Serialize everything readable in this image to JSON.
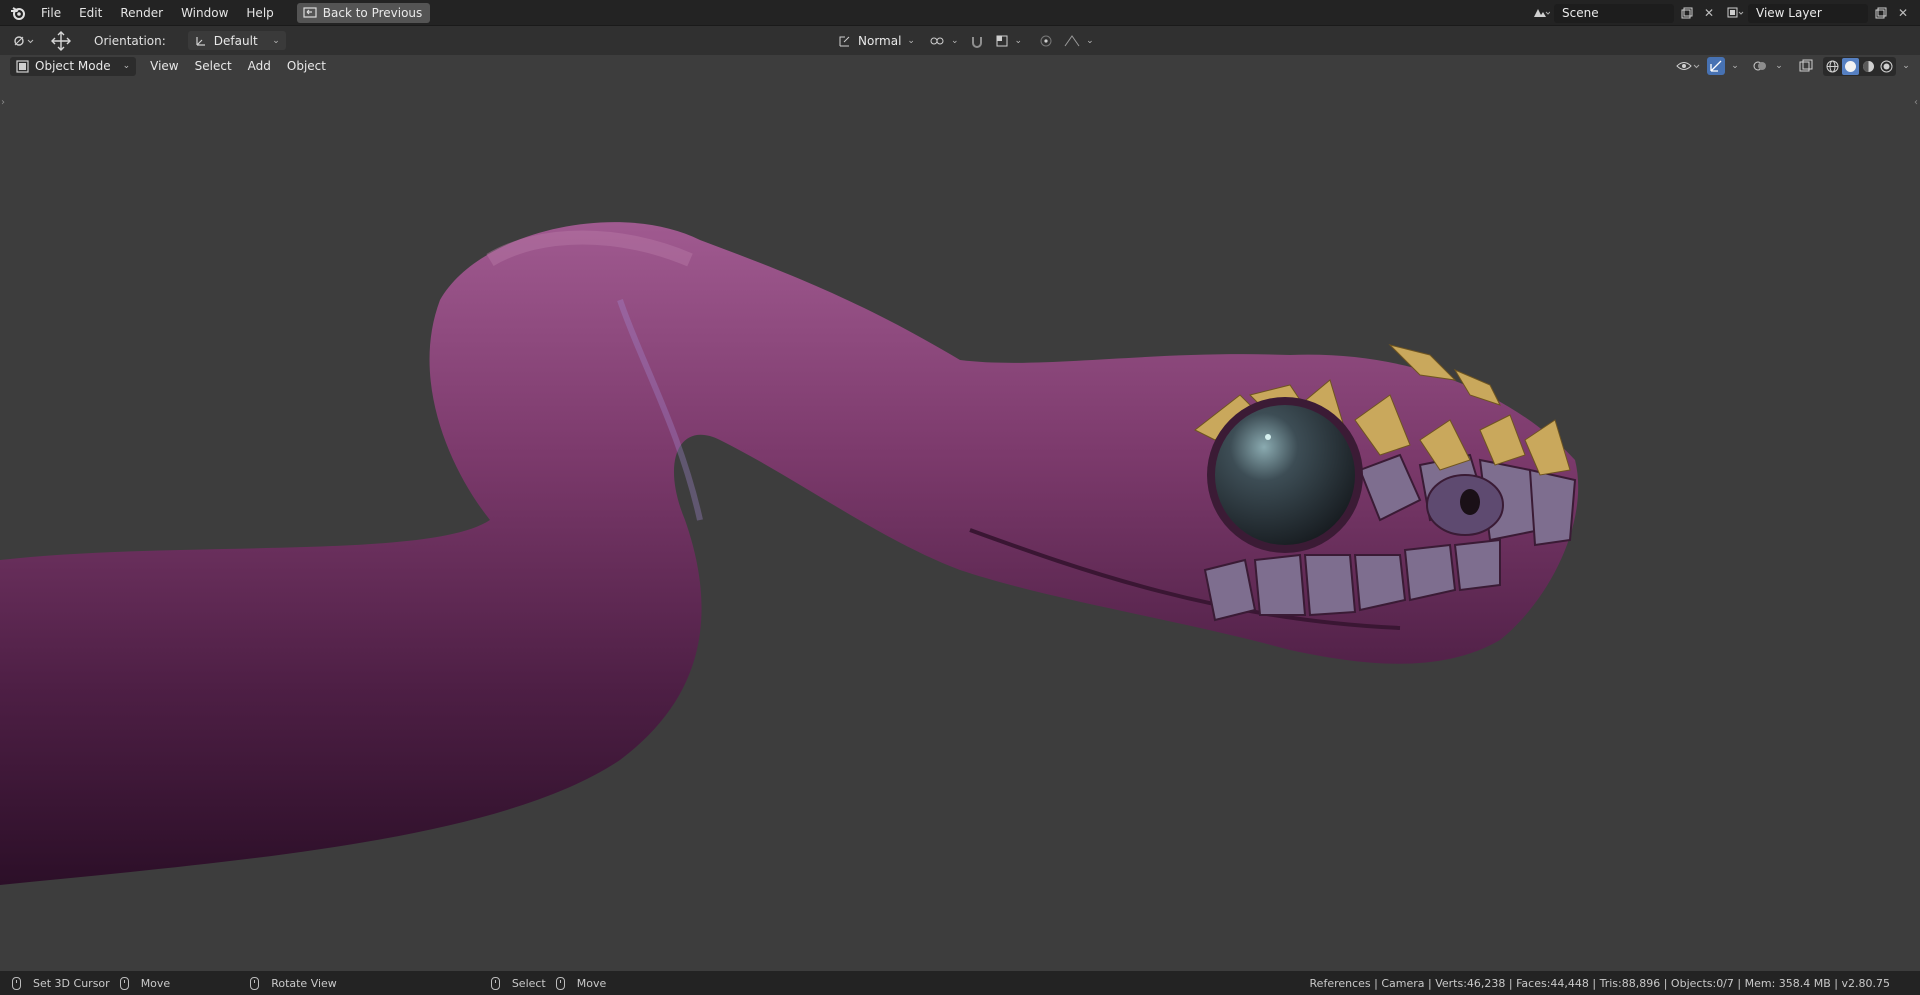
{
  "topbar": {
    "menus": [
      "File",
      "Edit",
      "Render",
      "Window",
      "Help"
    ],
    "back_button": "Back to Previous",
    "scene": "Scene",
    "view_layer": "View Layer"
  },
  "header": {
    "orientation_label": "Orientation:",
    "orientation_value": "Default",
    "pivot_value": "Normal"
  },
  "viewport_header": {
    "mode": "Object Mode",
    "menus": [
      "View",
      "Select",
      "Add",
      "Object"
    ]
  },
  "statusbar": {
    "left_click": "Set 3D Cursor",
    "left_drag": "Move",
    "middle": "Rotate View",
    "right_click": "Select",
    "right_drag": "Move",
    "stats": "References | Camera | Verts:46,238 | Faces:44,448 | Tris:88,896 | Objects:0/7 | Mem: 358.4 MB | v2.80.75"
  },
  "colors": {
    "accent": "#4772b3",
    "snake_body": "#6b2c5a",
    "viewport_bg": "#3d3d3d"
  }
}
